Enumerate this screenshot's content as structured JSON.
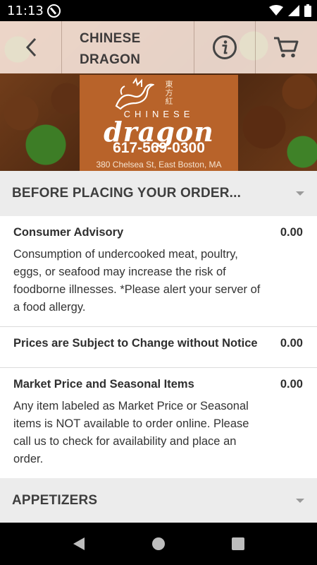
{
  "status_bar": {
    "time": "11:13",
    "icons": [
      "notification-q-icon",
      "wifi-icon",
      "signal-icon",
      "battery-icon"
    ]
  },
  "header": {
    "title_line1": "CHINESE",
    "title_line2": "DRAGON",
    "back_icon": "back-chevron-icon",
    "info_icon": "info-icon",
    "cart_icon": "cart-icon"
  },
  "banner": {
    "brand_small": "CHINESE",
    "brand_big": "dragon",
    "phone": "617-569-0300",
    "address": "380 Chelsea St, East Boston, MA",
    "chinese_chars": "東方紅"
  },
  "sections": [
    {
      "title": "BEFORE PLACING YOUR ORDER...",
      "items": [
        {
          "name": "Consumer Advisory",
          "price": "0.00",
          "description": "Consumption of undercooked meat, poultry, eggs, or seafood may increase the risk of foodborne illnesses. *Please alert your server of a food allergy."
        },
        {
          "name": "Prices are Subject to Change without Notice",
          "price": "0.00",
          "description": ""
        },
        {
          "name": "Market Price and Seasonal Items",
          "price": "0.00",
          "description": "Any item labeled as Market Price or Seasonal items is NOT available to order online. Please call us to check for availability and place an order."
        }
      ]
    },
    {
      "title": "APPETIZERS",
      "items": []
    }
  ],
  "colors": {
    "banner_orange": "#b8632a",
    "section_header_bg": "#ececec",
    "text_dark": "#2f2f2f"
  },
  "system_nav": {
    "icons": [
      "back-triangle-icon",
      "home-circle-icon",
      "recents-square-icon"
    ]
  }
}
